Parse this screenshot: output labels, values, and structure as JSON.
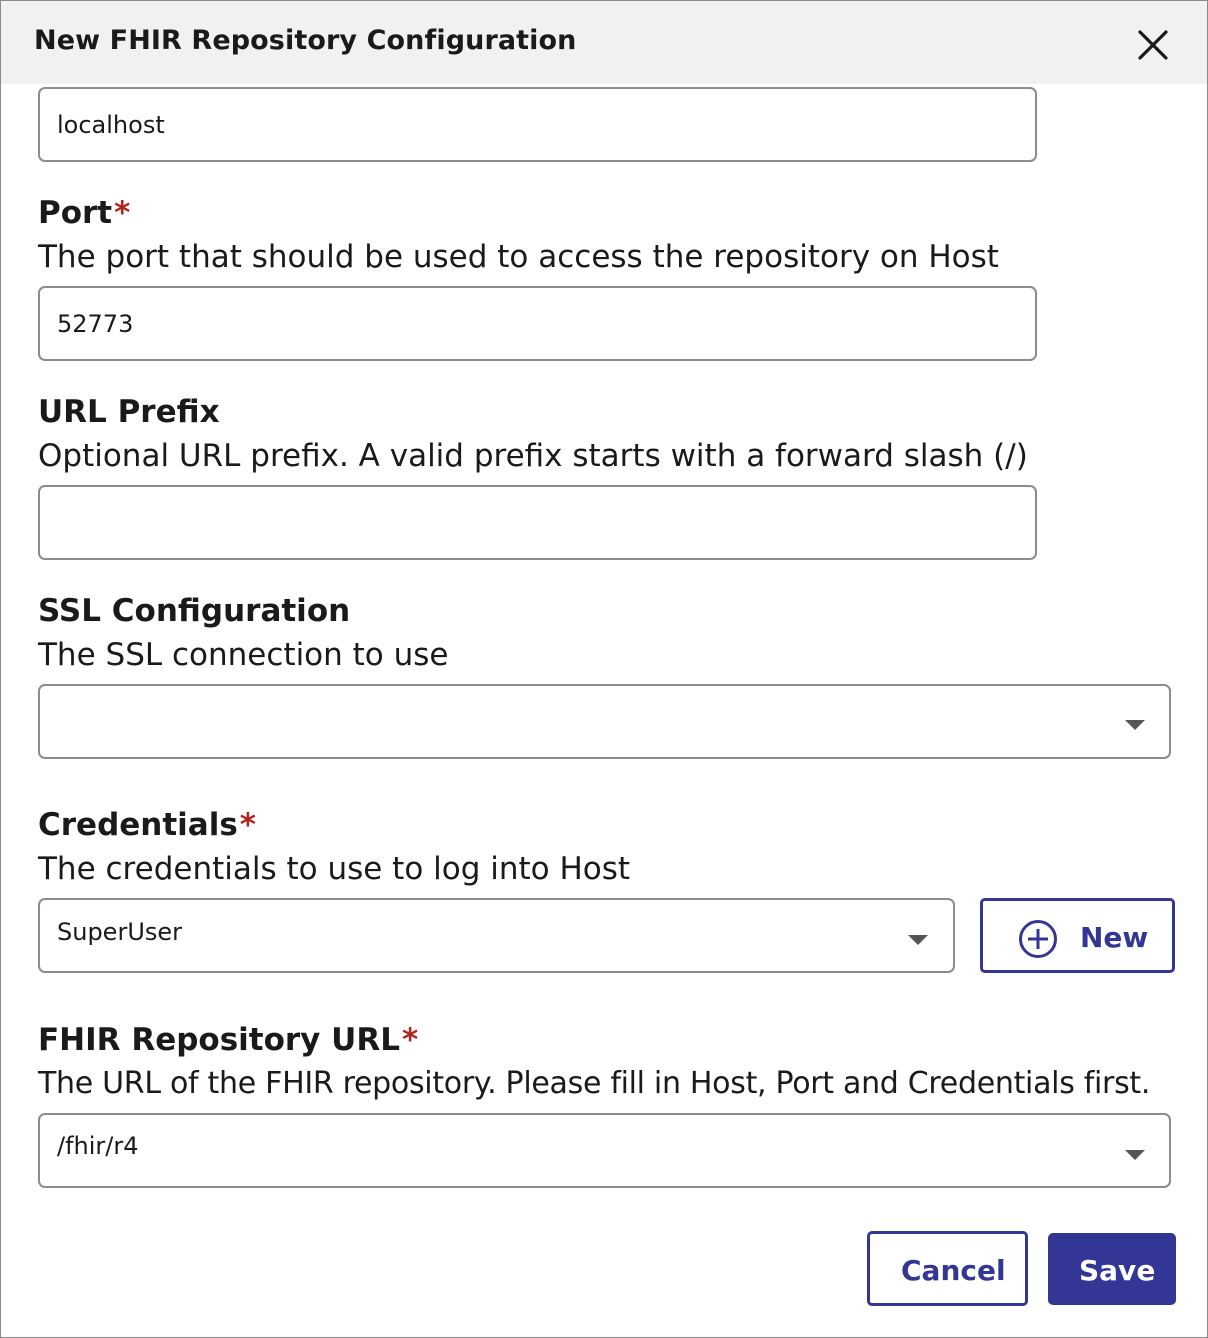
{
  "dialog": {
    "title": "New FHIR Repository Configuration",
    "close_icon": "close-icon"
  },
  "host": {
    "value": "localhost"
  },
  "port": {
    "label": "Port",
    "required_mark": "*",
    "help": "The port that should be used to access the repository on Host",
    "value": "52773"
  },
  "url_prefix": {
    "label": "URL Prefix",
    "help": "Optional URL prefix. A valid prefix starts with a forward slash (/)",
    "value": ""
  },
  "ssl": {
    "label": "SSL Configuration",
    "help": "The SSL connection to use",
    "value": ""
  },
  "credentials": {
    "label": "Credentials",
    "required_mark": "*",
    "help": "The credentials to use to log into Host",
    "value": "SuperUser",
    "new_button_label": "New",
    "new_button_icon": "plus-circle-icon"
  },
  "fhir_url": {
    "label": "FHIR Repository URL",
    "required_mark": "*",
    "help": "The URL of the FHIR repository. Please fill in Host, Port and Credentials first.",
    "value": "/fhir/r4"
  },
  "footer": {
    "cancel_label": "Cancel",
    "save_label": "Save"
  },
  "colors": {
    "accent": "#333695",
    "required": "#b3261e",
    "header_bg": "#f1f1f1",
    "border": "#8c8c8c"
  }
}
